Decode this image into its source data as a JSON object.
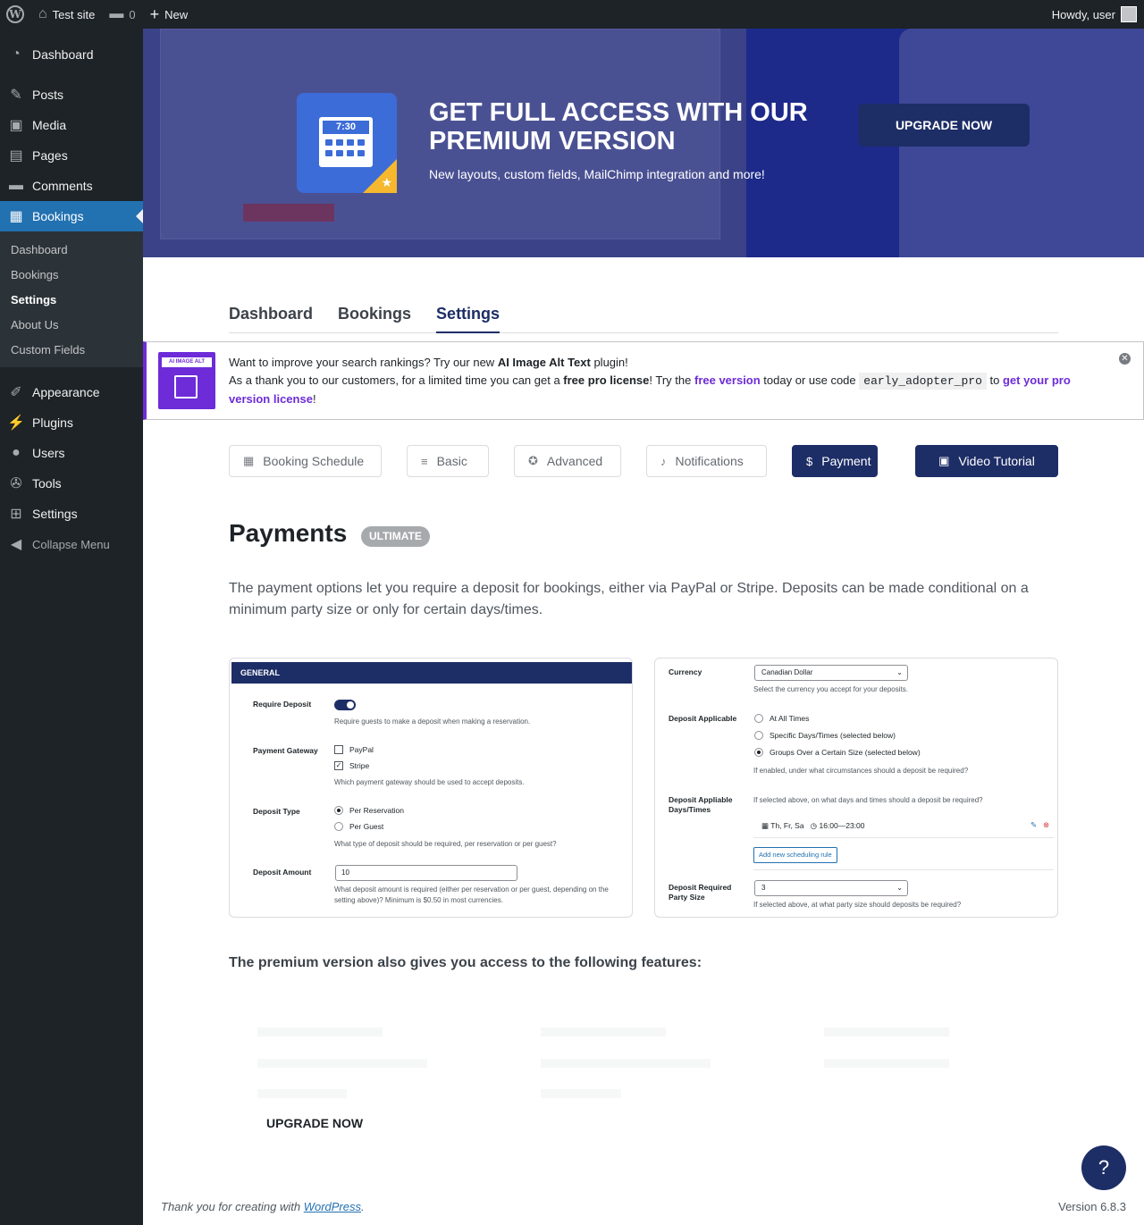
{
  "adminbar": {
    "site_name": "Test site",
    "comments_count": "0",
    "new_label": "New",
    "howdy": "Howdy, user"
  },
  "sidebar": {
    "items": [
      {
        "label": "Dashboard",
        "icon": "dashboard-icon"
      },
      {
        "label": "Posts",
        "icon": "pushpin-icon"
      },
      {
        "label": "Media",
        "icon": "media-icon"
      },
      {
        "label": "Pages",
        "icon": "pages-icon"
      },
      {
        "label": "Comments",
        "icon": "comment-icon"
      },
      {
        "label": "Bookings",
        "icon": "calendar-icon"
      },
      {
        "label": "Appearance",
        "icon": "brush-icon"
      },
      {
        "label": "Plugins",
        "icon": "plug-icon"
      },
      {
        "label": "Users",
        "icon": "user-icon"
      },
      {
        "label": "Tools",
        "icon": "wrench-icon"
      },
      {
        "label": "Settings",
        "icon": "settings-icon"
      }
    ],
    "submenu": [
      "Dashboard",
      "Bookings",
      "Settings",
      "About Us",
      "Custom Fields"
    ],
    "collapse": "Collapse Menu"
  },
  "banner": {
    "icon_time": "7:30",
    "title": "GET FULL ACCESS WITH OUR PREMIUM VERSION",
    "subtitle": "New layouts, custom fields, MailChimp integration and more!",
    "button": "UPGRADE NOW"
  },
  "tabs": [
    "Dashboard",
    "Bookings",
    "Settings"
  ],
  "notice": {
    "logo_text": "AI IMAGE ALT TEXT",
    "line1_a": "Want to improve your search rankings? Try our new ",
    "line1_b": "AI Image Alt Text",
    "line1_c": " plugin!",
    "line2_a": "As a thank you to our customers, for a limited time you can get a ",
    "line2_b": "free pro license",
    "line2_c": "! Try the ",
    "line2_link": "free version",
    "line2_d": " today or use code ",
    "line2_code": "early_adopter_pro",
    "line2_e": " to ",
    "line2_link2": "get your pro version license",
    "line2_f": "!"
  },
  "subtabs": {
    "booking_schedule": "Booking Schedule",
    "basic": "Basic",
    "advanced": "Advanced",
    "notifications": "Notifications",
    "payment": "Payment",
    "video": "Video Tutorial"
  },
  "payments": {
    "title": "Payments",
    "badge": "ULTIMATE",
    "description": "The payment options let you require a deposit for bookings, either via PayPal or Stripe. Deposits can be made conditional on a minimum party size or only for certain days/times."
  },
  "preview_left": {
    "section": "GENERAL",
    "require_deposit": "Require Deposit",
    "require_help": "Require guests to make a deposit when making a reservation.",
    "gateway": "Payment Gateway",
    "paypal": "PayPal",
    "stripe": "Stripe",
    "gateway_help": "Which payment gateway should be used to accept deposits.",
    "deposit_type": "Deposit Type",
    "per_reservation": "Per Reservation",
    "per_guest": "Per Guest",
    "type_help": "What type of deposit should be required, per reservation or per guest?",
    "deposit_amount": "Deposit Amount",
    "amount_value": "10",
    "amount_help1": "What deposit amount is required (either per reservation or per guest, depending on the",
    "amount_help2": "setting above)? Minimum is $0.50 in most currencies."
  },
  "preview_right": {
    "currency": "Currency",
    "currency_value": "Canadian Dollar",
    "currency_help": "Select the currency you accept for your deposits.",
    "applicable": "Deposit Applicable",
    "at_all_times": "At All Times",
    "specific": "Specific Days/Times (selected below)",
    "groups": "Groups Over a Certain Size (selected below)",
    "applicable_help": "If enabled, under what circumstances should a deposit be required?",
    "days_label1": "Deposit Appliable",
    "days_label2": "Days/Times",
    "days_help": "If selected above, on what days and times should a deposit be required?",
    "days_value": "Th, Fr, Sa",
    "time_value": "16:00—23:00",
    "add_rule": "Add new scheduling rule",
    "party_label1": "Deposit Required",
    "party_label2": "Party Size",
    "party_value": "3",
    "party_help": "If selected above, at what party size should deposits be required?"
  },
  "premium_heading": "The premium version also gives you access to the following features:",
  "upgrade2": "UPGRADE NOW",
  "help_glyph": "?",
  "footer": {
    "thanks": "Thank you for creating with ",
    "wp": "WordPress",
    "period": ".",
    "version": "Version 6.8.3"
  }
}
